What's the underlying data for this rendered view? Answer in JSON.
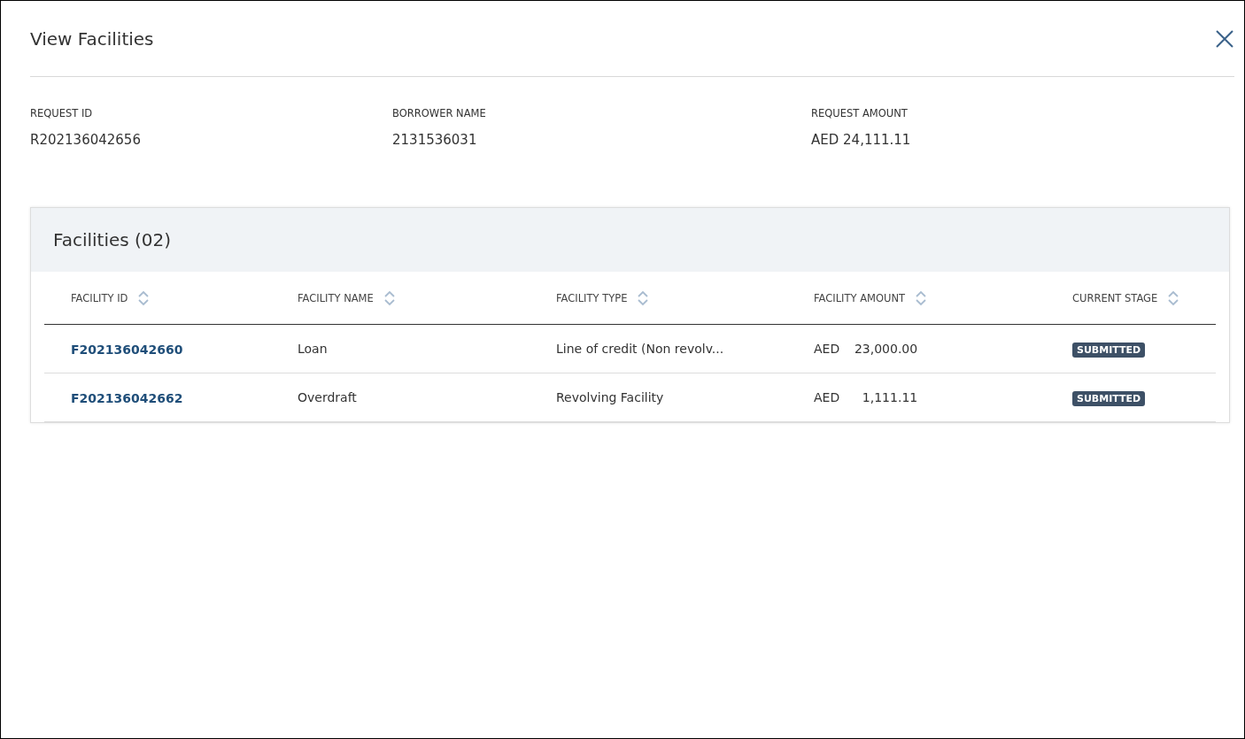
{
  "dialog": {
    "title": "View Facilities"
  },
  "summary": [
    {
      "label": "REQUEST ID",
      "value": "R202136042656"
    },
    {
      "label": "BORROWER NAME",
      "value": "2131536031"
    },
    {
      "label": "REQUEST AMOUNT",
      "value": "AED 24,111.11"
    }
  ],
  "facilities": {
    "title": "Facilities (02)",
    "columns": [
      "FACILITY ID",
      "FACILITY NAME",
      "FACILITY TYPE",
      "FACILITY AMOUNT",
      "CURRENT STAGE"
    ],
    "rows": [
      {
        "id": "F202136042660",
        "name": "Loan",
        "type": "Line of credit (Non revolv...",
        "currency": "AED",
        "amount": "23,000.00",
        "stage": "SUBMITTED"
      },
      {
        "id": "F202136042662",
        "name": "Overdraft",
        "type": "Revolving Facility",
        "currency": "AED",
        "amount": "1,111.11",
        "stage": "SUBMITTED"
      }
    ]
  }
}
